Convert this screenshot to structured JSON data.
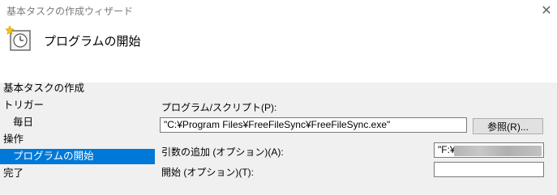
{
  "window": {
    "title": "基本タスクの作成ウィザード",
    "close_icon": "✕"
  },
  "header": {
    "icon": "clock-icon",
    "title": "プログラムの開始"
  },
  "nav": {
    "items": [
      {
        "label": "基本タスクの作成",
        "selected": false
      },
      {
        "label": "トリガー",
        "selected": false
      },
      {
        "label": "毎日",
        "selected": false
      },
      {
        "label": "操作",
        "selected": false
      },
      {
        "label": "プログラムの開始",
        "selected": true
      },
      {
        "label": "完了",
        "selected": false
      }
    ]
  },
  "form": {
    "program_label": "プログラム/スクリプト(P):",
    "program_value": "\"C:¥Program Files¥FreeFileSync¥FreeFileSync.exe\"",
    "browse_label": "参照(R)...",
    "args_label": "引数の追加 (オプション)(A):",
    "args_value": "\"F:¥",
    "start_label": "開始 (オプション)(T):",
    "start_value": ""
  },
  "colors": {
    "selection": "#0078d7",
    "panel": "#f0f0f0"
  }
}
